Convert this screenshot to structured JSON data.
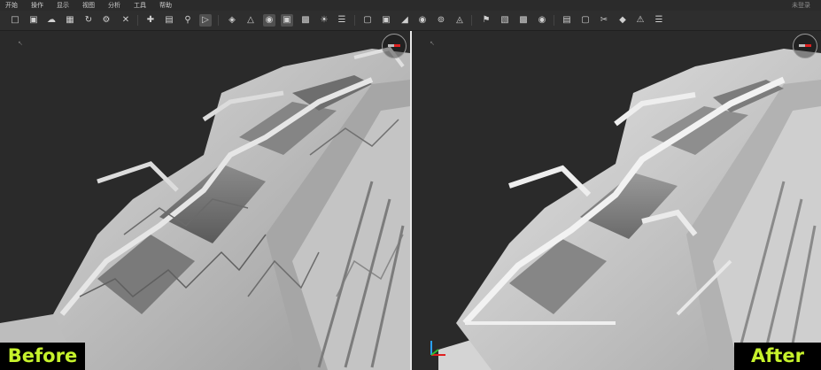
{
  "menubar": {
    "items": [
      "开始",
      "操作",
      "显示",
      "视图",
      "分析",
      "工具",
      "帮助"
    ],
    "login": "未登录"
  },
  "toolbar": {
    "icons": [
      "new-file-icon",
      "open-folder-icon",
      "cloud-icon",
      "save-icon",
      "refresh-icon",
      "settings-icon",
      "close-icon",
      "move-icon",
      "document-icon",
      "search-icon",
      "select-icon",
      "layer-icon",
      "points-icon",
      "mesh-icon",
      "display-icon",
      "sun-icon",
      "sliders-icon",
      "image-icon",
      "screenshot-icon",
      "resize-icon",
      "fill-icon",
      "crop-icon",
      "snapshot-icon",
      "flag-icon",
      "hatch-icon",
      "texture-icon",
      "pin-icon",
      "film-icon",
      "frame-icon",
      "cut-icon",
      "cube-icon",
      "warning-icon",
      "bars-icon"
    ],
    "active": [
      "select-icon",
      "mesh-icon",
      "display-icon"
    ]
  },
  "labels": {
    "before": "Before",
    "after": "After"
  },
  "colors": {
    "label_text": "#c6f22c",
    "label_bg": "#000000",
    "compass_north": "#e02020"
  }
}
